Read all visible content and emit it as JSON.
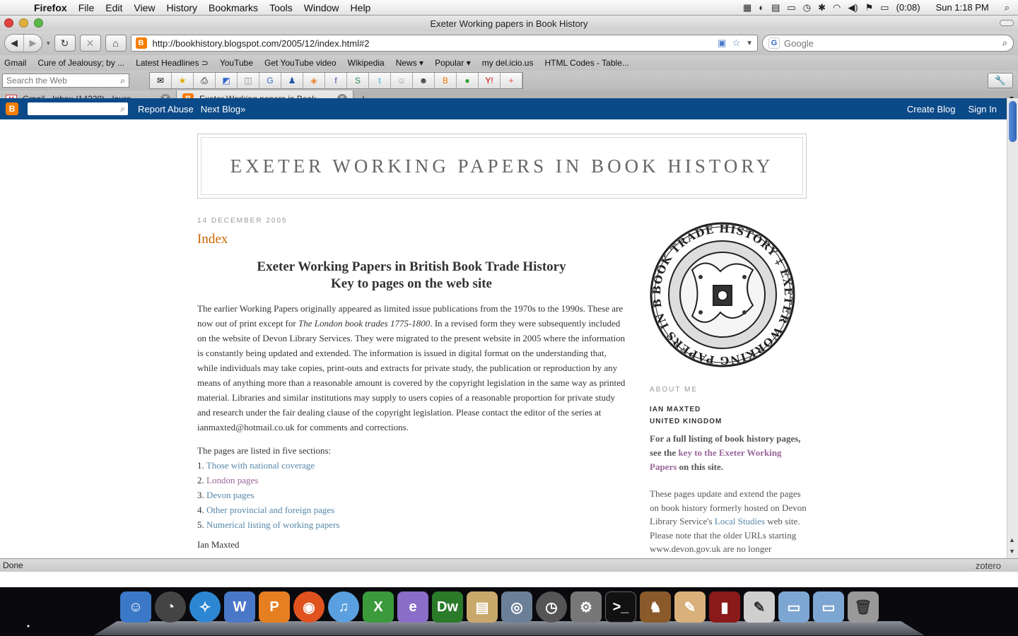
{
  "menubar": {
    "app": "Firefox",
    "items": [
      "File",
      "Edit",
      "View",
      "History",
      "Bookmarks",
      "Tools",
      "Window",
      "Help"
    ],
    "battery": "(0:08)",
    "clock": "Sun 1:18 PM"
  },
  "window": {
    "title": "Exeter Working papers in Book History"
  },
  "nav": {
    "url": "http://bookhistory.blogspot.com/2005/12/index.html#2",
    "search_placeholder": "Google"
  },
  "bookmarks": [
    "Gmail",
    "Cure of Jealousy; by ...",
    "Latest Headlines ⊃",
    "YouTube",
    "Get YouTube video",
    "Wikipedia",
    "News ▾",
    "Popular ▾",
    "my del.icio.us",
    "HTML Codes - Table..."
  ],
  "toolbar2": {
    "search_placeholder": "Search the Web"
  },
  "tabs": [
    {
      "label": "Gmail - Inbox (14220) - laura..."
    },
    {
      "label": "Exeter Working papers in Book ..."
    }
  ],
  "blogger": {
    "report": "Report Abuse",
    "next": "Next Blog»",
    "create": "Create Blog",
    "signin": "Sign In"
  },
  "blog": {
    "title": "EXETER WORKING PAPERS IN BOOK HISTORY",
    "date": "14 DECEMBER 2005",
    "post_title": "Index",
    "heading_line1": "Exeter Working Papers in British Book Trade History",
    "heading_line2": "Key to pages on the web site",
    "para1_a": "The earlier Working Papers originally appeared as limited issue publications from the 1970s to the 1990s. These are now out of print except for ",
    "para1_em": "The London book trades 1775-1800",
    "para1_b": ". In a revised form they were subsequently included on the website of Devon Library Services. They were migrated to the present website in 2005 where the information is constantly being updated and extended. The information is issued in digital format on the understanding that, while individuals may take copies, print-outs and extracts for private study, the publication or reproduction by any means of anything more than a reasonable amount is covered by the copyright legislation in the same way as printed material. Libraries and similar institutions may supply to users copies of a reasonable proportion for private study and research under the fair dealing clause of the copyright legislation. Please contact the editor of the series at ianmaxted@hotmail.co.uk for comments and corrections.",
    "list_intro": "The pages are listed in five sections:",
    "list": [
      {
        "num": "1.",
        "label": "Those with national coverage"
      },
      {
        "num": "2.",
        "label": "London pages"
      },
      {
        "num": "3.",
        "label": "Devon pages"
      },
      {
        "num": "4.",
        "label": "Other provincial and foreign pages"
      },
      {
        "num": "5.",
        "label": "Numerical listing of working papers"
      }
    ],
    "cut_text": "Ian Maxted"
  },
  "sidebar": {
    "seal_text": "BOOK TRADE HISTORY ‡ EXETER WORKING PAPERS IN BRITISH",
    "about_title": "ABOUT ME",
    "name": "IAN MAXTED",
    "country": "UNITED KINGDOM",
    "bold_a": "For a full listing of book history pages, see the ",
    "bold_link": "key to the Exeter Working Papers",
    "bold_b": " on this site.",
    "desc_a": "These pages update and extend the pages on book history formerly hosted on Devon Library Service's ",
    "desc_link": "Local Studies",
    "desc_b": " web site. Please note that the older URLs starting www.devon.gov.uk are no longer operative, although they are still to be"
  },
  "status": {
    "text": "Done",
    "zotero": "zotero"
  }
}
